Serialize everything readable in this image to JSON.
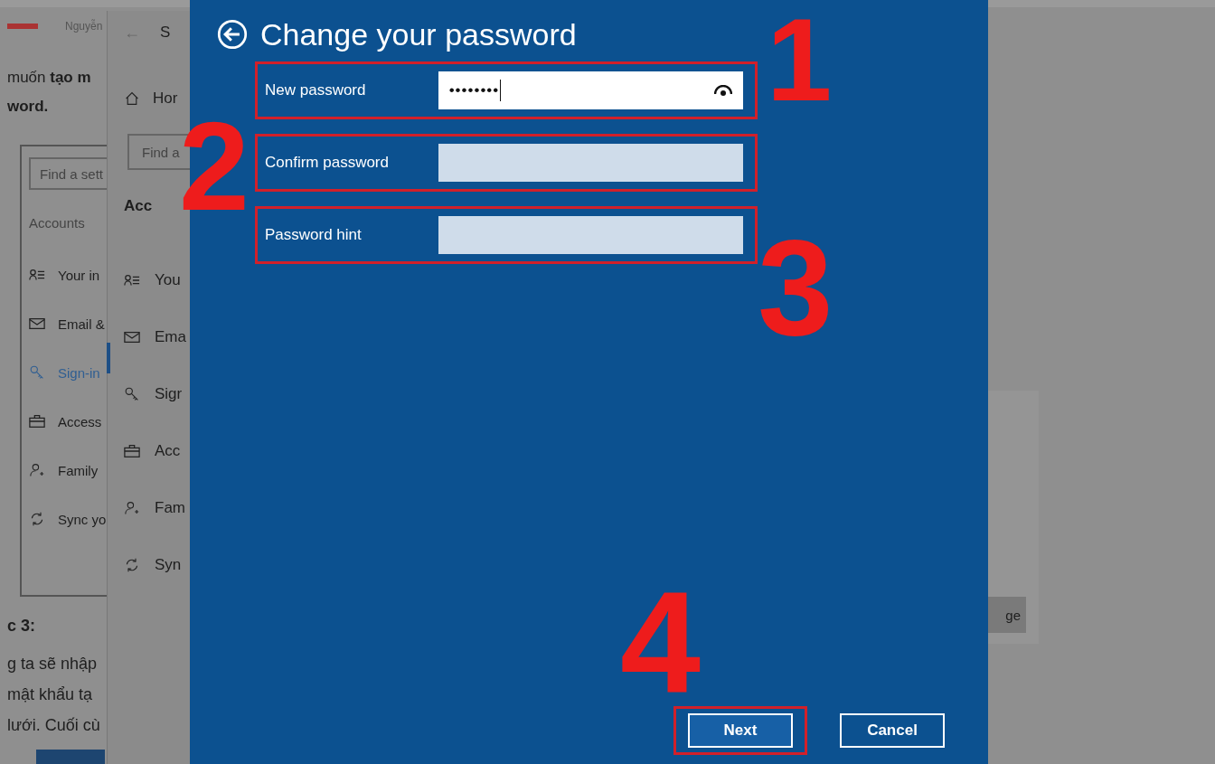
{
  "browser": {
    "tab_text": "Nguyễn"
  },
  "article": {
    "intro": "muốn **tạo m**",
    "intro_end": "word.",
    "step_heading": "c 3:",
    "body_lines": [
      "g ta sẽ nhập",
      "mật khẩu tạ",
      "lưới. Cuối cù"
    ],
    "embedded_settings": {
      "search_placeholder": "Find a sett",
      "section": "Accounts",
      "items": [
        {
          "label": "Your in",
          "selected": false
        },
        {
          "label": "Email &",
          "selected": false
        },
        {
          "label": "Sign-in",
          "selected": true
        },
        {
          "label": "Access",
          "selected": false
        },
        {
          "label": "Family",
          "selected": false
        },
        {
          "label": "Sync yo",
          "selected": false
        }
      ]
    }
  },
  "settings_window": {
    "back": "←",
    "title": "S",
    "home": "Hor",
    "search_placeholder": "Find a",
    "section": "Acc",
    "items": [
      {
        "label": "You",
        "selected": false
      },
      {
        "label": "Ema",
        "selected": false
      },
      {
        "label": "Sigr",
        "selected": true
      },
      {
        "label": "Acc",
        "selected": false
      },
      {
        "label": "Fam",
        "selected": false
      },
      {
        "label": "Syn",
        "selected": false
      }
    ]
  },
  "dialog": {
    "title": "Change your password",
    "fields": [
      {
        "label": "New password",
        "value": "••••••••",
        "kind": "password",
        "highlighted": true
      },
      {
        "label": "Confirm password",
        "kind": "password",
        "highlighted": true
      },
      {
        "label": "Password hint",
        "kind": "text",
        "highlighted": true
      }
    ],
    "buttons": [
      {
        "label": "Next",
        "primary": true,
        "highlighted": true
      },
      {
        "label": "Cancel",
        "primary": false,
        "highlighted": false
      }
    ]
  },
  "right_panel": {
    "button": "ge"
  },
  "annotations": [
    {
      "label": "1"
    },
    {
      "label": "2"
    },
    {
      "label": "3"
    },
    {
      "label": "4"
    }
  ]
}
